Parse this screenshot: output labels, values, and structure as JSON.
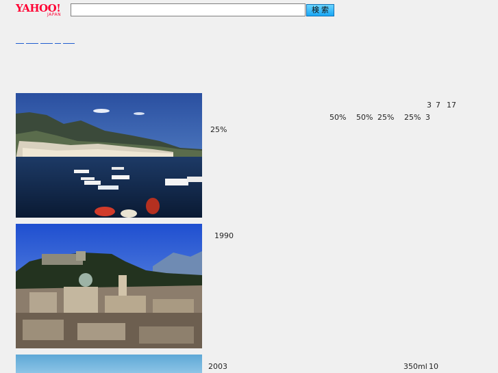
{
  "header": {
    "logo_text": "YAHOO!",
    "logo_sub": "JAPAN",
    "search_placeholder": "",
    "search_value": "",
    "search_button": "検 索"
  },
  "nav": {
    "links": [
      "",
      "",
      "",
      ""
    ]
  },
  "articles": [
    {
      "image_icon": "coastal-town-photo",
      "texts": [
        "3",
        "7",
        "17",
        "50%",
        "50%",
        "25%",
        "25%",
        "3",
        "25%"
      ]
    },
    {
      "image_icon": "castle-city-photo",
      "texts": [
        "1990"
      ]
    },
    {
      "image_icon": "sky-photo",
      "texts": [
        "2003",
        "350ml",
        "10"
      ]
    }
  ],
  "colors": {
    "background": "#f0f0f0",
    "brand": "#ff0033",
    "link": "#1e5ccf",
    "button": "#1aa7f5"
  }
}
